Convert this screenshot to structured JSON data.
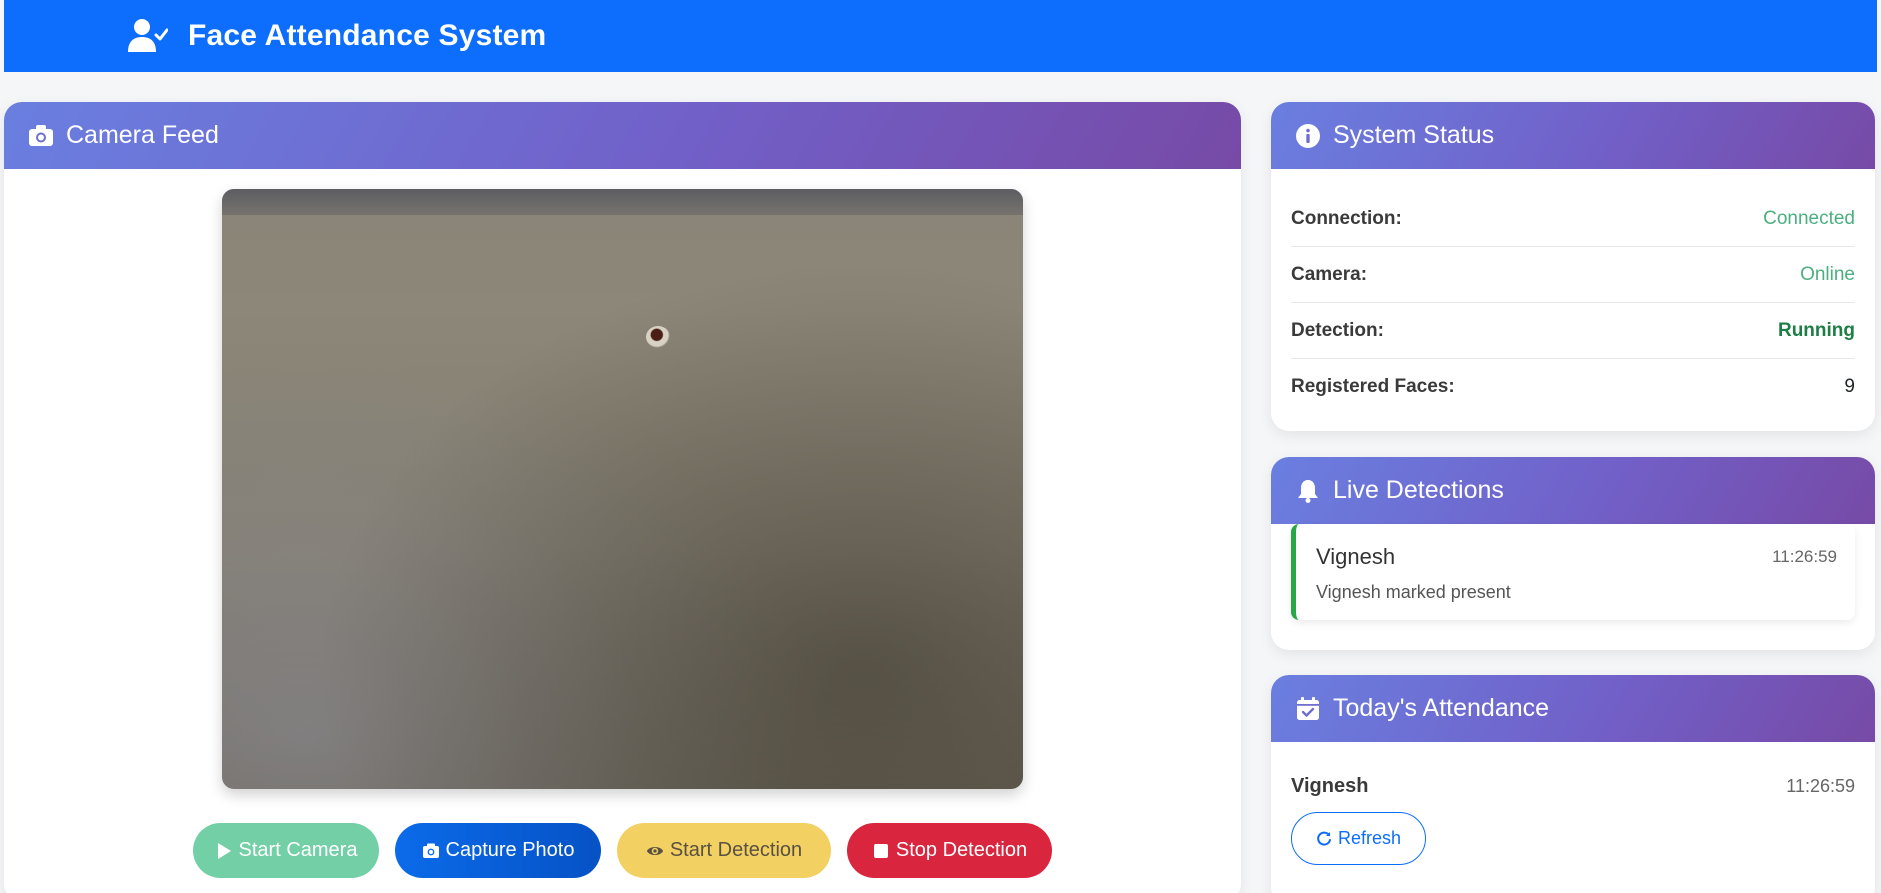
{
  "app": {
    "title": "Face Attendance System",
    "icon": "user-check-icon"
  },
  "colors": {
    "primary": "#0d6efd",
    "header_gradient_start": "#6a7fe0",
    "header_gradient_end": "#774aa6",
    "success": "#28a745",
    "connected_green": "#4caf7f",
    "running_green": "#1e7e45",
    "danger": "#d9263e",
    "warning": "#f2d061"
  },
  "camera": {
    "title": "Camera Feed",
    "icon": "camera-icon",
    "buttons": {
      "start_camera": "Start Camera",
      "capture_photo": "Capture Photo",
      "start_detection": "Start Detection",
      "stop_detection": "Stop Detection"
    }
  },
  "status": {
    "title": "System Status",
    "icon": "info-circle-icon",
    "rows": [
      {
        "label": "Connection:",
        "value": "Connected",
        "color": "#4caf7f"
      },
      {
        "label": "Camera:",
        "value": "Online",
        "color": "#4caf7f"
      },
      {
        "label": "Detection:",
        "value": "Running",
        "color": "#1e7e45"
      },
      {
        "label": "Registered Faces:",
        "value": "9",
        "color": "#212529"
      }
    ]
  },
  "detections": {
    "title": "Live Detections",
    "icon": "bell-icon",
    "items": [
      {
        "name": "Vignesh",
        "time": "11:26:59",
        "message": "Vignesh marked present"
      }
    ]
  },
  "attendance": {
    "title": "Today's Attendance",
    "icon": "calendar-check-icon",
    "items": [
      {
        "name": "Vignesh",
        "time": "11:26:59"
      }
    ],
    "refresh_label": "Refresh"
  }
}
